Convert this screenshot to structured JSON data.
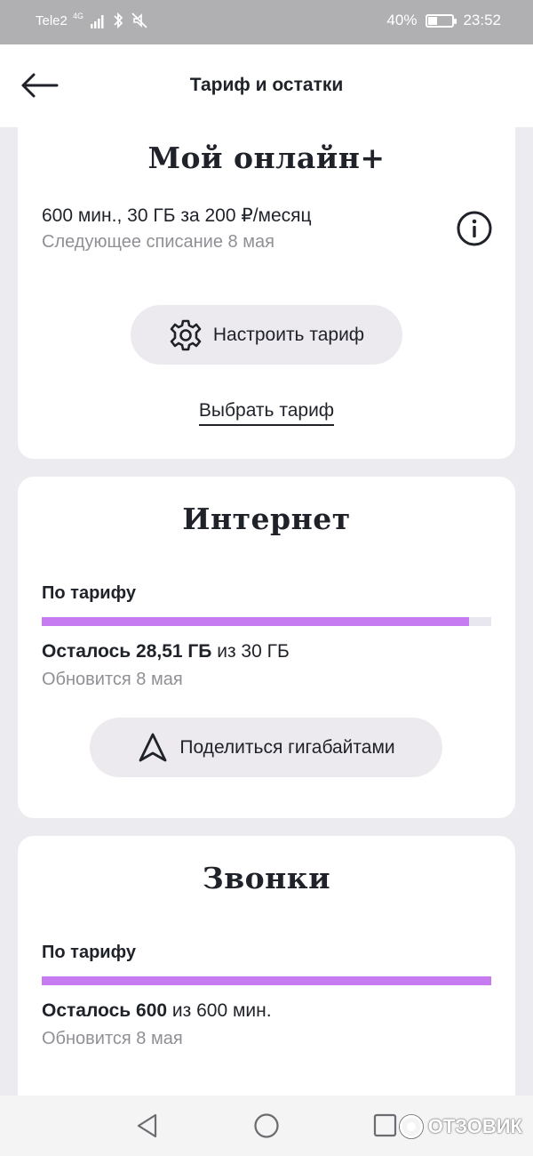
{
  "status_bar": {
    "carrier": "Tele2",
    "network": "4G",
    "battery_percent": "40%",
    "battery_level": 0.4,
    "time": "23:52"
  },
  "header": {
    "title": "Тариф и остатки",
    "back_icon": "arrow-left-icon"
  },
  "tariff": {
    "name": "Мой онлайн+",
    "price_line": "600 мин., 30 ГБ за 200 ₽/месяц",
    "next_charge": "Следующее списание 8 мая",
    "info_icon": "info-icon",
    "configure_label": "Настроить тариф",
    "configure_icon": "gear-icon",
    "choose_label": "Выбрать тариф"
  },
  "internet": {
    "title": "Интернет",
    "label": "По тарифу",
    "remaining_prefix": "Осталось 28,51 ГБ",
    "remaining_suffix": " из 30 ГБ",
    "remaining": 28.51,
    "total": 30,
    "refresh": "Обновится 8 мая",
    "share_label": "Поделиться гигабайтами",
    "share_icon": "navigation-arrow-icon"
  },
  "calls": {
    "title": "Звонки",
    "label": "По тарифу",
    "remaining_prefix": "Осталось 600",
    "remaining_suffix": " из 600 мин.",
    "remaining": 600,
    "total": 600,
    "refresh": "Обновится 8 мая"
  },
  "nav_bar": {
    "back_icon": "triangle-back-icon",
    "home_icon": "circle-home-icon",
    "recents_icon": "square-recents-icon"
  },
  "watermark": {
    "text": "ОТЗОВИК"
  },
  "colors": {
    "accent": "#c77bf0",
    "background": "#ecebef",
    "card": "#ffffff",
    "pill": "#eceaee",
    "muted_text": "#8f9096",
    "text": "#1f2229"
  }
}
